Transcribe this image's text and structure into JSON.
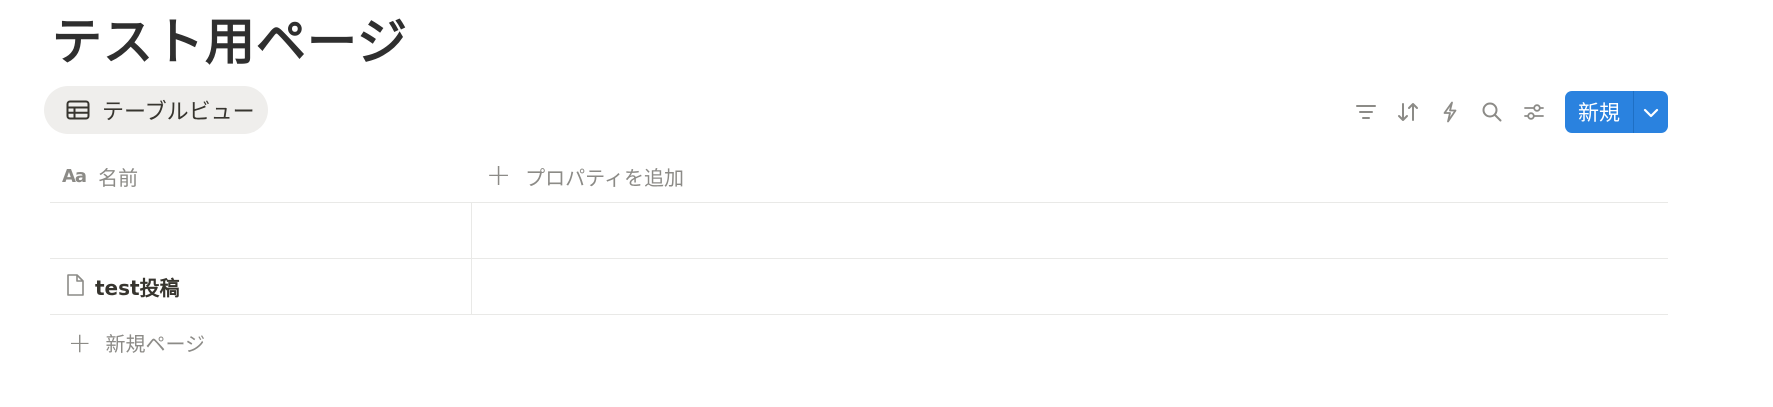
{
  "page": {
    "title": "テスト用ページ"
  },
  "view": {
    "tab_label": "テーブルビュー",
    "tab_icon": "table-icon"
  },
  "toolbar": {
    "icons": [
      "filter-icon",
      "sort-icon",
      "lightning-icon",
      "search-icon",
      "settings-sliders-icon"
    ],
    "new_label": "新規",
    "new_dropdown_icon": "chevron-down-icon",
    "accent_color": "#2a82df"
  },
  "table": {
    "columns": {
      "name_icon_text": "Aa",
      "name_label": "名前",
      "add_property_label": "プロパティを追加"
    },
    "rows": [
      {
        "name": ""
      },
      {
        "name": "test投稿",
        "icon": "document-icon"
      }
    ],
    "new_page_label": "新規ページ"
  }
}
